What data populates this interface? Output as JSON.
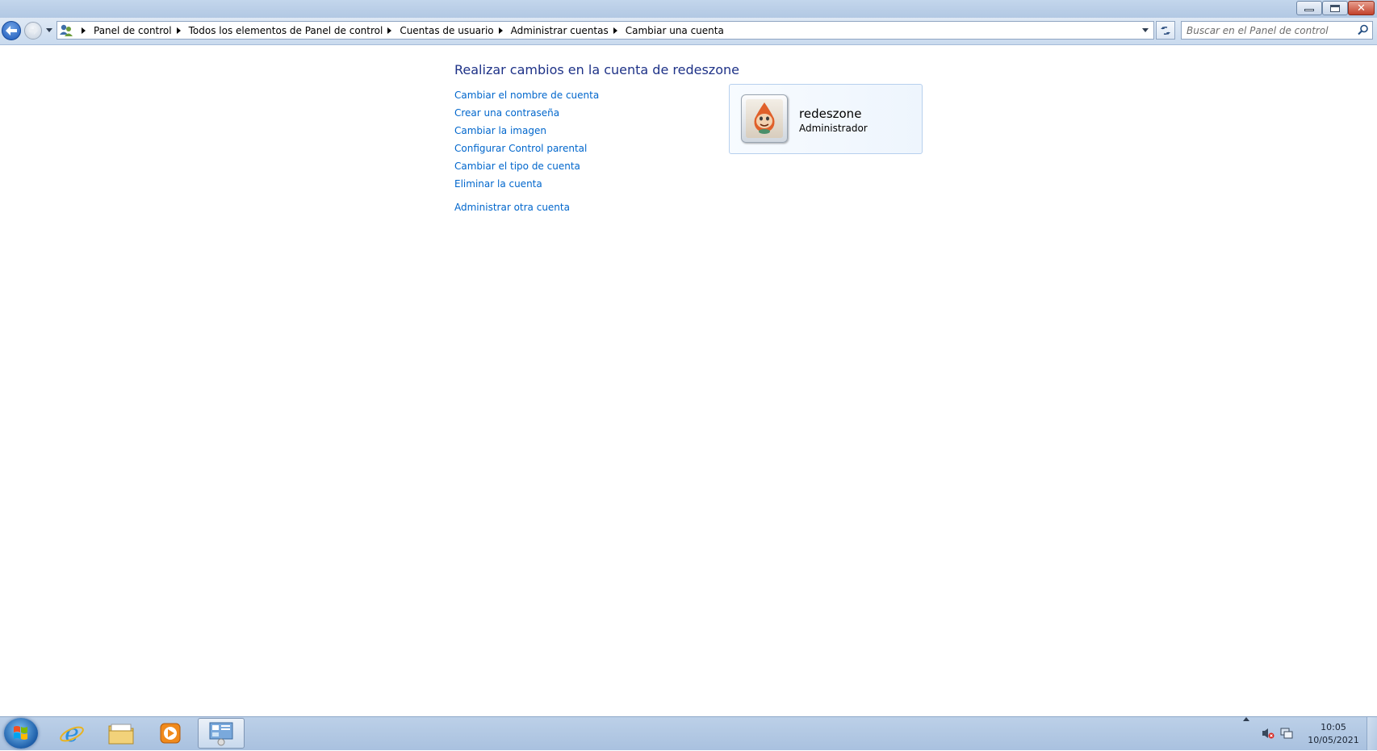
{
  "window": {
    "minimize_icon": "minimize-icon",
    "maximize_icon": "restore-icon",
    "close_icon": "close-icon"
  },
  "nav": {
    "back_icon": "back-arrow-icon",
    "forward_icon": "forward-arrow-icon",
    "address_icon": "user-accounts-icon",
    "breadcrumb": [
      "Panel de control",
      "Todos los elementos de Panel de control",
      "Cuentas de usuario",
      "Administrar cuentas",
      "Cambiar una cuenta"
    ],
    "search_placeholder": "Buscar en el Panel de control"
  },
  "main": {
    "title": "Realizar cambios en la cuenta de redeszone",
    "tasks": [
      "Cambiar el nombre de cuenta",
      "Crear una contraseña",
      "Cambiar la imagen",
      "Configurar Control parental",
      "Cambiar el tipo de cuenta",
      "Eliminar la cuenta"
    ],
    "other_link": "Administrar otra cuenta",
    "account": {
      "name": "redeszone",
      "type": "Administrador"
    }
  },
  "taskbar": {
    "apps": [
      "internet-explorer-icon",
      "windows-explorer-icon",
      "media-player-icon",
      "control-panel-icon"
    ],
    "clock_time": "10:05",
    "clock_date": "10/05/2021"
  },
  "colors": {
    "link": "#0066cc",
    "title": "#1e3287",
    "taskbar": "#bcd0e8"
  }
}
